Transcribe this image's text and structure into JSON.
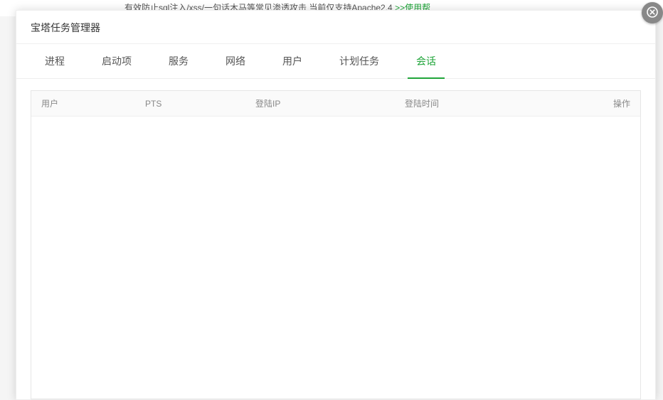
{
  "backdrop": {
    "text_prefix": "有效防止sql注入/xss/一句话木马等常见渗透攻击 当前仅支持Apache2.4 ",
    "link": ">>使用帮"
  },
  "modal": {
    "title": "宝塔任务管理器"
  },
  "tabs": [
    {
      "label": "进程",
      "active": false
    },
    {
      "label": "启动项",
      "active": false
    },
    {
      "label": "服务",
      "active": false
    },
    {
      "label": "网络",
      "active": false
    },
    {
      "label": "用户",
      "active": false
    },
    {
      "label": "计划任务",
      "active": false
    },
    {
      "label": "会话",
      "active": true
    }
  ],
  "table": {
    "columns": {
      "user": "用户",
      "pts": "PTS",
      "ip": "登陆IP",
      "time": "登陆时间",
      "op": "操作"
    },
    "rows": []
  }
}
